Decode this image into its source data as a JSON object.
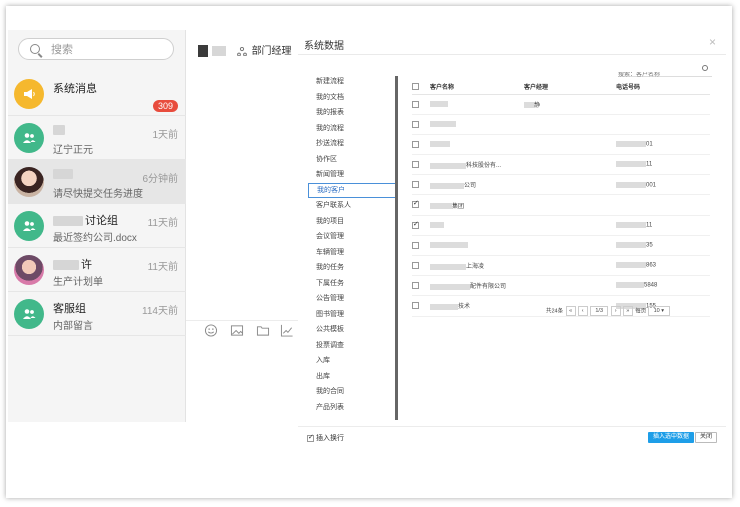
{
  "search": {
    "placeholder": "搜索"
  },
  "chats": [
    {
      "name": "系统消息",
      "sub": "",
      "time": "",
      "badge": "309",
      "avatar": "megaphone-icon"
    },
    {
      "name": "",
      "sub": "辽宁正元",
      "time": "1天前",
      "avatar": "group-icon"
    },
    {
      "name": "",
      "sub": "请尽快提交任务进度",
      "time": "6分钟前",
      "avatar": "photo"
    },
    {
      "name": "讨论组",
      "sub": "最近签约公司.docx",
      "time": "11天前",
      "avatar": "group-icon"
    },
    {
      "name": "许",
      "sub": "生产计划单",
      "time": "11天前",
      "avatar": "photo"
    },
    {
      "name": "客服组",
      "sub": "内部留言",
      "time": "114天前",
      "avatar": "group-icon"
    }
  ],
  "conversation": {
    "title": "部门经理"
  },
  "dialog": {
    "title": "系统数据",
    "close": "×",
    "search_placeholder": "搜索：客户名称",
    "menu": [
      "新建流程",
      "我的文档",
      "我的报表",
      "我的流程",
      "抄送流程",
      "协作区",
      "新闻管理",
      "我的客户",
      "客户联系人",
      "我的项目",
      "会议管理",
      "车辆管理",
      "我的任务",
      "下属任务",
      "公告管理",
      "图书管理",
      "公共模板",
      "投票调查",
      "入库",
      "出库",
      "我的合同",
      "产品列表"
    ],
    "selected_menu": "我的客户",
    "columns": {
      "name": "客户名称",
      "manager": "客户经理",
      "phone": "电话号码"
    },
    "rows": [
      {
        "checked": false,
        "name": "",
        "manager": "静",
        "phone": ""
      },
      {
        "checked": false,
        "name": "",
        "manager": "",
        "phone": ""
      },
      {
        "checked": false,
        "name": "",
        "manager": "",
        "phone": "01"
      },
      {
        "checked": false,
        "name": "科技股份有...",
        "manager": "",
        "phone": "11"
      },
      {
        "checked": false,
        "name": "公司",
        "manager": "",
        "phone": "001"
      },
      {
        "checked": true,
        "name": "集团",
        "manager": "",
        "phone": ""
      },
      {
        "checked": true,
        "name": "",
        "manager": "",
        "phone": "11"
      },
      {
        "checked": false,
        "name": "",
        "manager": "",
        "phone": "35"
      },
      {
        "checked": false,
        "name": "上海凌",
        "manager": "",
        "phone": "863"
      },
      {
        "checked": false,
        "name": "配件有限公司",
        "manager": "",
        "phone": "5848"
      },
      {
        "checked": false,
        "name": "技术",
        "manager": "",
        "phone": "155"
      }
    ],
    "pager": {
      "total": "共24条",
      "page": "1/3",
      "per_page_label": "每页",
      "per_page": "10"
    },
    "insert_newline": "插入换行",
    "insert_button": "插入选中数据",
    "close_button": "关闭"
  }
}
